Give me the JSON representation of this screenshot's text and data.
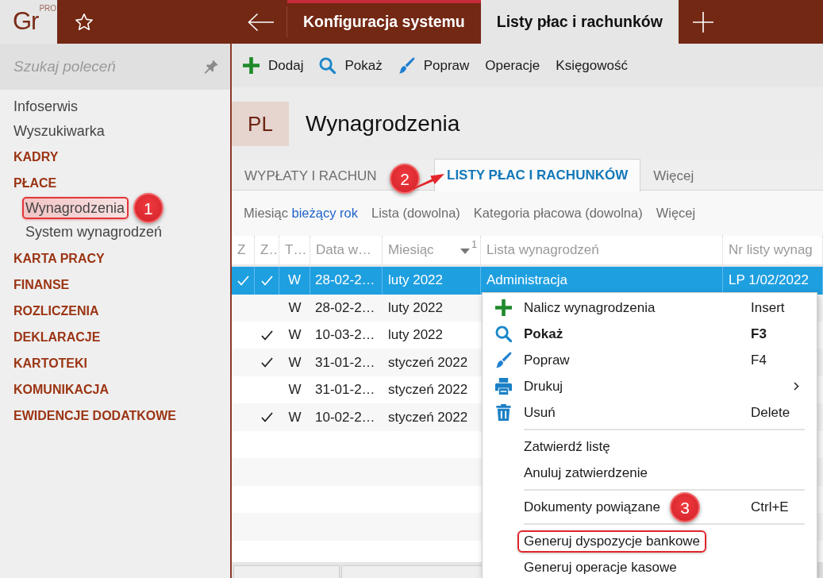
{
  "app": {
    "logo": "Gr",
    "edition": "PRO"
  },
  "top_tabs": [
    {
      "label": "Konfiguracja systemu",
      "selected": false
    },
    {
      "label": "Listy płac i rachunków",
      "selected": true
    }
  ],
  "sidebar": {
    "search": {
      "placeholder": "Szukaj poleceń"
    },
    "items": [
      {
        "label": "Infoserwis",
        "kind": "link"
      },
      {
        "label": "Wyszukiwarka",
        "kind": "link"
      },
      {
        "label": "KADRY",
        "kind": "section"
      },
      {
        "label": "PŁACE",
        "kind": "section",
        "children": [
          {
            "label": "Wynagrodzenia",
            "highlighted": true,
            "callout": "1"
          },
          {
            "label": "System wynagrodzeń",
            "highlighted": false
          }
        ]
      },
      {
        "label": "KARTA PRACY",
        "kind": "section"
      },
      {
        "label": "FINANSE",
        "kind": "section"
      },
      {
        "label": "ROZLICZENIA",
        "kind": "section"
      },
      {
        "label": "DEKLARACJE",
        "kind": "section"
      },
      {
        "label": "KARTOTEKI",
        "kind": "section"
      },
      {
        "label": "KOMUNIKACJA",
        "kind": "section"
      },
      {
        "label": "EWIDENCJE DODATKOWE",
        "kind": "section"
      }
    ]
  },
  "toolbar": [
    {
      "label": "Dodaj",
      "kind": "icon"
    },
    {
      "label": "Pokaż",
      "kind": "icon"
    },
    {
      "label": "Popraw",
      "kind": "icon"
    },
    {
      "label": "Operacje",
      "kind": "text"
    },
    {
      "label": "Księgowość",
      "kind": "text"
    }
  ],
  "header": {
    "badge": "PL",
    "title": "Wynagrodzenia"
  },
  "tabs": [
    {
      "label": "WYPŁATY I RACHUN",
      "selected": false
    },
    {
      "label": "LISTY PŁAC I RACHUNKÓW",
      "selected": true,
      "callout": "2"
    },
    {
      "label": "Więcej",
      "selected": false
    }
  ],
  "filters": [
    {
      "label": "Miesiąc",
      "value": "bieżący rok"
    },
    {
      "label": "Lista (dowolna)"
    },
    {
      "label": "Kategoria płacowa (dowolna)"
    },
    {
      "label": "Więcej"
    }
  ],
  "table": {
    "columns": [
      {
        "label": "Z"
      },
      {
        "label": "Z…"
      },
      {
        "label": "T…"
      },
      {
        "label": "Data w…"
      },
      {
        "label": "Miesiąc",
        "sort_index": "1"
      },
      {
        "label": "Lista wynagrodzeń"
      },
      {
        "label": "Nr listy wynag"
      }
    ],
    "rows": [
      {
        "selected": true,
        "cells": [
          {
            "checked": true
          },
          {
            "checked": true
          },
          "W",
          "28-02-2…",
          "luty 2022",
          "Administracja",
          "LP 1/02/2022"
        ]
      },
      {
        "selected": false,
        "cells": [
          {
            "checked": false
          },
          {
            "checked": false
          },
          "W",
          "28-02-2…",
          "luty 2022"
        ]
      },
      {
        "selected": false,
        "cells": [
          {
            "checked": false
          },
          {
            "checked": true
          },
          "W",
          "10-03-2…",
          "luty 2022"
        ]
      },
      {
        "selected": false,
        "cells": [
          {
            "checked": false
          },
          {
            "checked": true
          },
          "W",
          "31-01-2…",
          "styczeń 2022"
        ]
      },
      {
        "selected": false,
        "cells": [
          {
            "checked": false
          },
          {
            "checked": false
          },
          "W",
          "31-01-2…",
          "styczeń 2022"
        ]
      },
      {
        "selected": false,
        "cells": [
          {
            "checked": false
          },
          {
            "checked": true
          },
          "W",
          "10-02-2…",
          "styczeń 2022"
        ]
      }
    ]
  },
  "context_menu": {
    "groups": [
      {
        "items": [
          {
            "label": "Nalicz wynagrodzenia",
            "shortcut": "Insert",
            "default": false,
            "submenu": false,
            "highlighted": false
          },
          {
            "label": "Pokaż",
            "shortcut": "F3",
            "default": true,
            "submenu": false,
            "highlighted": false
          },
          {
            "label": "Popraw",
            "shortcut": "F4",
            "default": false,
            "submenu": false,
            "highlighted": false
          },
          {
            "label": "Drukuj",
            "default": false,
            "submenu": true,
            "highlighted": false
          },
          {
            "label": "Usuń",
            "shortcut": "Delete",
            "default": false,
            "submenu": false,
            "highlighted": false
          }
        ]
      },
      {
        "items": [
          {
            "label": "Zatwierdź listę",
            "default": false,
            "submenu": false,
            "highlighted": false
          },
          {
            "label": "Anuluj zatwierdzenie",
            "default": false,
            "submenu": false,
            "highlighted": false
          }
        ]
      },
      {
        "items": [
          {
            "label": "Dokumenty powiązane",
            "shortcut": "Ctrl+E",
            "default": false,
            "submenu": false,
            "highlighted": false
          }
        ]
      },
      {
        "items": [
          {
            "label": "Generuj dyspozycje bankowe",
            "default": false,
            "submenu": false,
            "highlighted": true,
            "callout": "3"
          },
          {
            "label": "Generuj operacje kasowe",
            "default": false,
            "submenu": false,
            "highlighted": false
          }
        ]
      }
    ]
  }
}
